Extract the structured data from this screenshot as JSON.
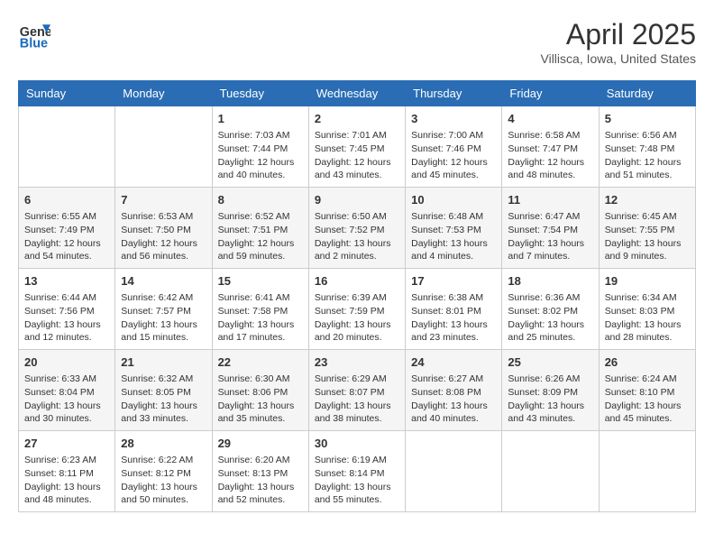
{
  "header": {
    "logo_line1": "General",
    "logo_line2": "Blue",
    "month_title": "April 2025",
    "location": "Villisca, Iowa, United States"
  },
  "days_of_week": [
    "Sunday",
    "Monday",
    "Tuesday",
    "Wednesday",
    "Thursday",
    "Friday",
    "Saturday"
  ],
  "weeks": [
    [
      {
        "day": "",
        "sunrise": "",
        "sunset": "",
        "daylight": ""
      },
      {
        "day": "",
        "sunrise": "",
        "sunset": "",
        "daylight": ""
      },
      {
        "day": "1",
        "sunrise": "Sunrise: 7:03 AM",
        "sunset": "Sunset: 7:44 PM",
        "daylight": "Daylight: 12 hours and 40 minutes."
      },
      {
        "day": "2",
        "sunrise": "Sunrise: 7:01 AM",
        "sunset": "Sunset: 7:45 PM",
        "daylight": "Daylight: 12 hours and 43 minutes."
      },
      {
        "day": "3",
        "sunrise": "Sunrise: 7:00 AM",
        "sunset": "Sunset: 7:46 PM",
        "daylight": "Daylight: 12 hours and 45 minutes."
      },
      {
        "day": "4",
        "sunrise": "Sunrise: 6:58 AM",
        "sunset": "Sunset: 7:47 PM",
        "daylight": "Daylight: 12 hours and 48 minutes."
      },
      {
        "day": "5",
        "sunrise": "Sunrise: 6:56 AM",
        "sunset": "Sunset: 7:48 PM",
        "daylight": "Daylight: 12 hours and 51 minutes."
      }
    ],
    [
      {
        "day": "6",
        "sunrise": "Sunrise: 6:55 AM",
        "sunset": "Sunset: 7:49 PM",
        "daylight": "Daylight: 12 hours and 54 minutes."
      },
      {
        "day": "7",
        "sunrise": "Sunrise: 6:53 AM",
        "sunset": "Sunset: 7:50 PM",
        "daylight": "Daylight: 12 hours and 56 minutes."
      },
      {
        "day": "8",
        "sunrise": "Sunrise: 6:52 AM",
        "sunset": "Sunset: 7:51 PM",
        "daylight": "Daylight: 12 hours and 59 minutes."
      },
      {
        "day": "9",
        "sunrise": "Sunrise: 6:50 AM",
        "sunset": "Sunset: 7:52 PM",
        "daylight": "Daylight: 13 hours and 2 minutes."
      },
      {
        "day": "10",
        "sunrise": "Sunrise: 6:48 AM",
        "sunset": "Sunset: 7:53 PM",
        "daylight": "Daylight: 13 hours and 4 minutes."
      },
      {
        "day": "11",
        "sunrise": "Sunrise: 6:47 AM",
        "sunset": "Sunset: 7:54 PM",
        "daylight": "Daylight: 13 hours and 7 minutes."
      },
      {
        "day": "12",
        "sunrise": "Sunrise: 6:45 AM",
        "sunset": "Sunset: 7:55 PM",
        "daylight": "Daylight: 13 hours and 9 minutes."
      }
    ],
    [
      {
        "day": "13",
        "sunrise": "Sunrise: 6:44 AM",
        "sunset": "Sunset: 7:56 PM",
        "daylight": "Daylight: 13 hours and 12 minutes."
      },
      {
        "day": "14",
        "sunrise": "Sunrise: 6:42 AM",
        "sunset": "Sunset: 7:57 PM",
        "daylight": "Daylight: 13 hours and 15 minutes."
      },
      {
        "day": "15",
        "sunrise": "Sunrise: 6:41 AM",
        "sunset": "Sunset: 7:58 PM",
        "daylight": "Daylight: 13 hours and 17 minutes."
      },
      {
        "day": "16",
        "sunrise": "Sunrise: 6:39 AM",
        "sunset": "Sunset: 7:59 PM",
        "daylight": "Daylight: 13 hours and 20 minutes."
      },
      {
        "day": "17",
        "sunrise": "Sunrise: 6:38 AM",
        "sunset": "Sunset: 8:01 PM",
        "daylight": "Daylight: 13 hours and 23 minutes."
      },
      {
        "day": "18",
        "sunrise": "Sunrise: 6:36 AM",
        "sunset": "Sunset: 8:02 PM",
        "daylight": "Daylight: 13 hours and 25 minutes."
      },
      {
        "day": "19",
        "sunrise": "Sunrise: 6:34 AM",
        "sunset": "Sunset: 8:03 PM",
        "daylight": "Daylight: 13 hours and 28 minutes."
      }
    ],
    [
      {
        "day": "20",
        "sunrise": "Sunrise: 6:33 AM",
        "sunset": "Sunset: 8:04 PM",
        "daylight": "Daylight: 13 hours and 30 minutes."
      },
      {
        "day": "21",
        "sunrise": "Sunrise: 6:32 AM",
        "sunset": "Sunset: 8:05 PM",
        "daylight": "Daylight: 13 hours and 33 minutes."
      },
      {
        "day": "22",
        "sunrise": "Sunrise: 6:30 AM",
        "sunset": "Sunset: 8:06 PM",
        "daylight": "Daylight: 13 hours and 35 minutes."
      },
      {
        "day": "23",
        "sunrise": "Sunrise: 6:29 AM",
        "sunset": "Sunset: 8:07 PM",
        "daylight": "Daylight: 13 hours and 38 minutes."
      },
      {
        "day": "24",
        "sunrise": "Sunrise: 6:27 AM",
        "sunset": "Sunset: 8:08 PM",
        "daylight": "Daylight: 13 hours and 40 minutes."
      },
      {
        "day": "25",
        "sunrise": "Sunrise: 6:26 AM",
        "sunset": "Sunset: 8:09 PM",
        "daylight": "Daylight: 13 hours and 43 minutes."
      },
      {
        "day": "26",
        "sunrise": "Sunrise: 6:24 AM",
        "sunset": "Sunset: 8:10 PM",
        "daylight": "Daylight: 13 hours and 45 minutes."
      }
    ],
    [
      {
        "day": "27",
        "sunrise": "Sunrise: 6:23 AM",
        "sunset": "Sunset: 8:11 PM",
        "daylight": "Daylight: 13 hours and 48 minutes."
      },
      {
        "day": "28",
        "sunrise": "Sunrise: 6:22 AM",
        "sunset": "Sunset: 8:12 PM",
        "daylight": "Daylight: 13 hours and 50 minutes."
      },
      {
        "day": "29",
        "sunrise": "Sunrise: 6:20 AM",
        "sunset": "Sunset: 8:13 PM",
        "daylight": "Daylight: 13 hours and 52 minutes."
      },
      {
        "day": "30",
        "sunrise": "Sunrise: 6:19 AM",
        "sunset": "Sunset: 8:14 PM",
        "daylight": "Daylight: 13 hours and 55 minutes."
      },
      {
        "day": "",
        "sunrise": "",
        "sunset": "",
        "daylight": ""
      },
      {
        "day": "",
        "sunrise": "",
        "sunset": "",
        "daylight": ""
      },
      {
        "day": "",
        "sunrise": "",
        "sunset": "",
        "daylight": ""
      }
    ]
  ]
}
